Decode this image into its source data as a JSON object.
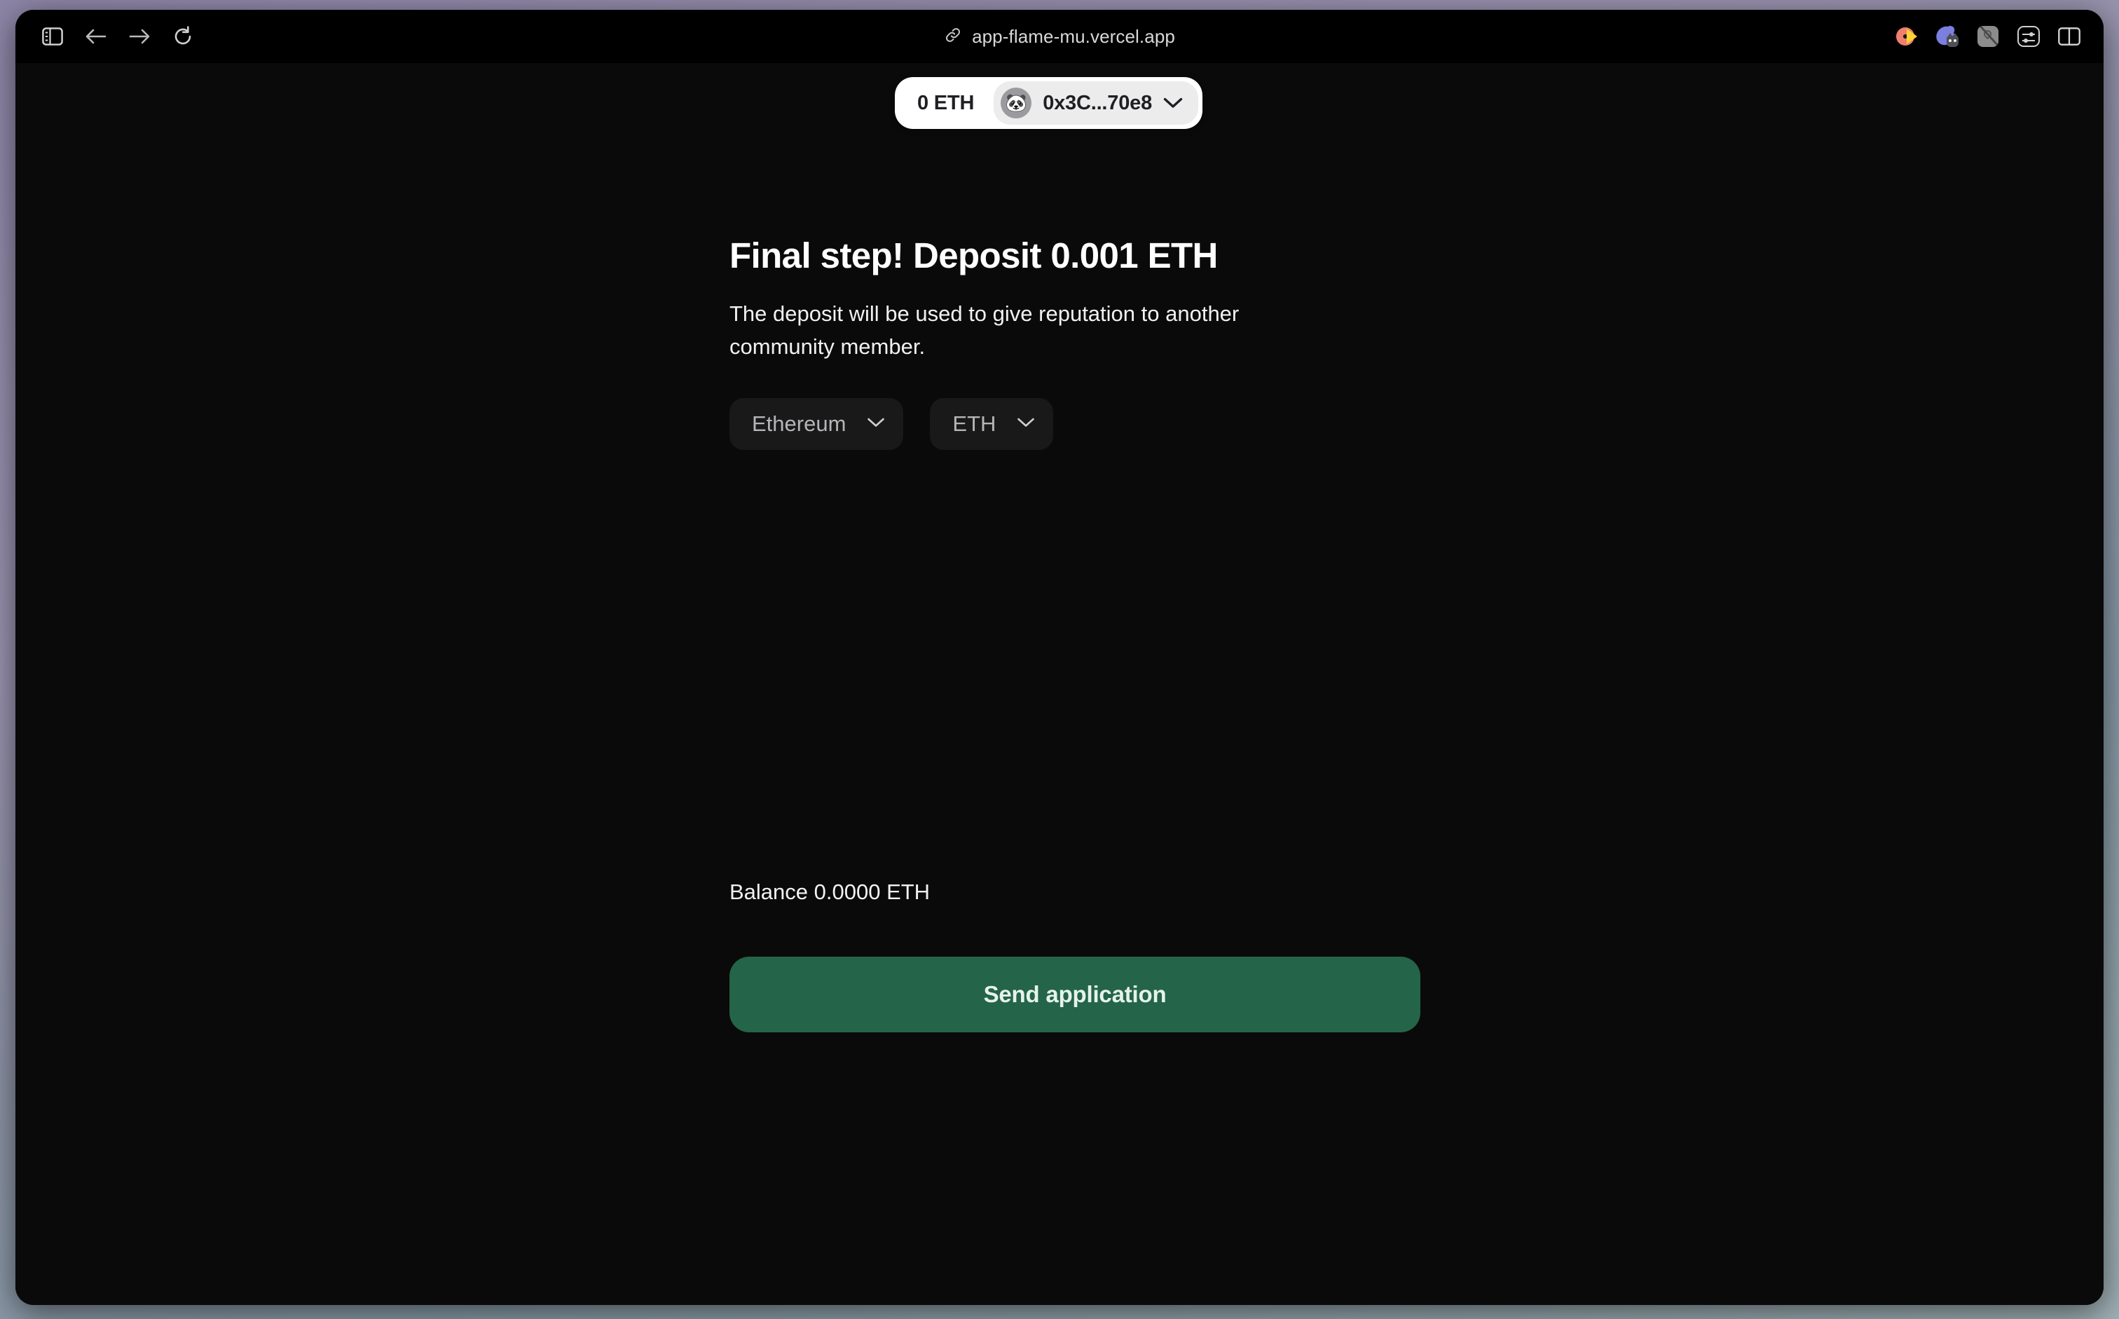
{
  "browser": {
    "url": "app-flame-mu.vercel.app",
    "url_icon": "link-icon",
    "nav": {
      "sidebar_toggle": "sidebar-toggle-icon",
      "back": "back-arrow-icon",
      "forward": "forward-arrow-icon",
      "reload": "reload-icon"
    },
    "extensions": [
      {
        "name": "rainbow-wallet-extension-icon"
      },
      {
        "name": "cat-extension-icon"
      },
      {
        "name": "muted-extension-icon"
      },
      {
        "name": "sliders-extension-icon"
      }
    ],
    "tab_overview": "split-view-icon"
  },
  "wallet": {
    "balance": "0 ETH",
    "avatar_glyph": "🐼",
    "avatar_name": "panda-avatar",
    "address": "0x3C...70e8",
    "chevron": "chevron-down-icon"
  },
  "main": {
    "title": "Final step! Deposit 0.001 ETH",
    "subtitle": "The deposit will be used to give reputation to another community member.",
    "network_selector": {
      "value": "Ethereum",
      "chevron": "chevron-down-icon"
    },
    "token_selector": {
      "value": "ETH",
      "chevron": "chevron-down-icon"
    },
    "balance_label": "Balance 0.0000 ETH",
    "submit_label": "Send application"
  },
  "colors": {
    "page_background": "#0a0a0a",
    "toolbar_background": "#000000",
    "accent_green": "#246448",
    "pill_white": "#ffffff",
    "pill_inner_gray": "#ececed",
    "selector_background": "#19191a",
    "muted_text": "#b5b5b8"
  }
}
